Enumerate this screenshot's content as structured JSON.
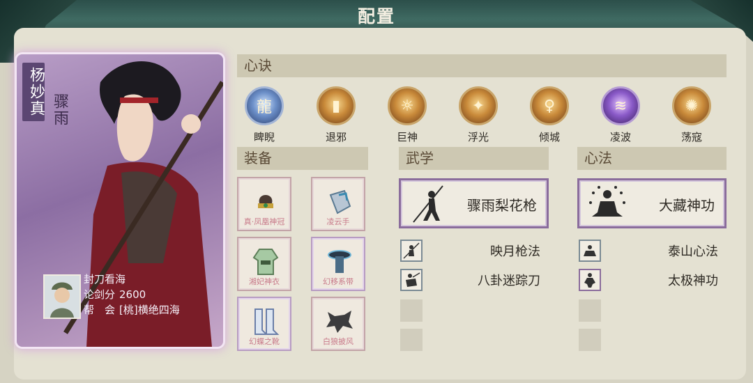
{
  "window": {
    "title": "配置"
  },
  "character": {
    "name": "杨妙真",
    "title": "骤雨",
    "nickname": "封刀看海",
    "score_label": "论剑分",
    "score": "2600",
    "guild_label": "帮　会",
    "guild": "[桃]横绝四海"
  },
  "sections": {
    "heart": "心诀",
    "equip": "装备",
    "martial": "武学",
    "method": "心法"
  },
  "heart_skills": [
    {
      "label": "睥睨",
      "icon": "blue-dragon-icon"
    },
    {
      "label": "退邪",
      "icon": "gold-talisman-icon"
    },
    {
      "label": "巨神",
      "icon": "gold-beast-icon"
    },
    {
      "label": "浮光",
      "icon": "gold-light-icon"
    },
    {
      "label": "倾城",
      "icon": "gold-figure-icon"
    },
    {
      "label": "凌波",
      "icon": "purple-swirl-icon"
    },
    {
      "label": "荡寇",
      "icon": "gold-flame-icon"
    }
  ],
  "equipment": [
    {
      "label": "真·凤凰神冠",
      "icon": "crown-icon"
    },
    {
      "label": "凌云手",
      "icon": "gauntlet-icon"
    },
    {
      "label": "湘妃神衣",
      "icon": "robe-icon"
    },
    {
      "label": "幻移系带",
      "icon": "belt-icon"
    },
    {
      "label": "幻蝶之靴",
      "icon": "boots-icon"
    },
    {
      "label": "白狼披风",
      "icon": "wolf-cape-icon"
    }
  ],
  "martial": {
    "main": "骤雨梨花枪",
    "list": [
      "映月枪法",
      "八卦迷踪刀"
    ]
  },
  "method": {
    "main": "大藏神功",
    "list": [
      "泰山心法",
      "太极神功"
    ]
  },
  "colors": {
    "accent_purple": "#8a6c9c",
    "header_teal": "#3f6a62",
    "section_bg": "#cdc8b2"
  }
}
